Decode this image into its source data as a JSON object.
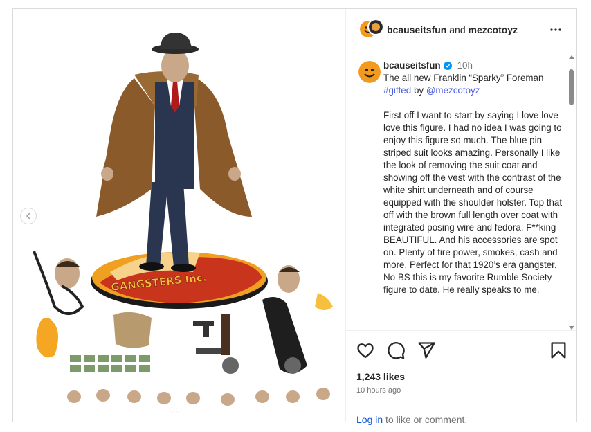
{
  "header": {
    "author": "bcauseitsfun",
    "conjunction": "and",
    "coauthor": "mezcotoyz"
  },
  "caption": {
    "username": "bcauseitsfun",
    "time": "10h",
    "title_line": "The all new Franklin “Sparky” Foreman",
    "hashtag": "#gifted",
    "by": "by",
    "mention": "@mezcotoyz",
    "body": "First off I want to start by saying I love love love this figure.  I had no idea I was going to enjoy this figure so much.  The blue pin striped suit looks amazing.  Personally I like the look of removing the suit coat and showing off the vest with the contrast of the white shirt underneath and of course equipped with the shoulder holster.  Top that off with the brown full length over coat with integrated posing wire and fedora.  F**king BEAUTIFUL.  And his accessories are spot on.  Plenty of fire power, smokes, cash and more.  Perfect for that 1920’s era gangster.  No BS this is my favorite Rumble Society figure to date.  He really speaks to me."
  },
  "media": {
    "base_text": "GANGSTERS Inc."
  },
  "stats": {
    "likes": "1,243 likes",
    "posted": "10 hours ago"
  },
  "footer": {
    "login": "Log in",
    "rest": "to like or comment."
  },
  "icons": [
    "chevron-left-icon",
    "more-icon",
    "heart-icon",
    "comment-icon",
    "share-icon",
    "bookmark-icon",
    "verified-icon"
  ],
  "colors": {
    "link": "#4a5de0",
    "login": "#0b58d6",
    "verified": "#0095f6",
    "coat": "#8b5a2b",
    "suit": "#2a3550"
  }
}
